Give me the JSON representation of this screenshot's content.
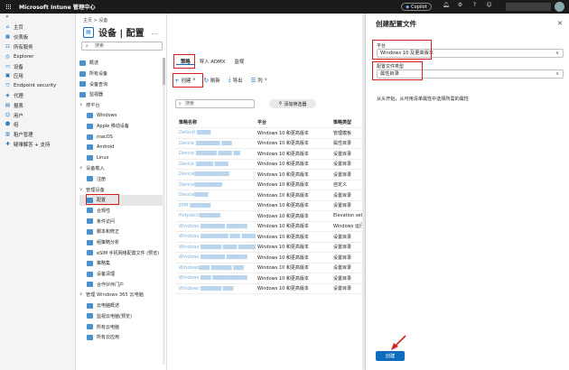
{
  "topbar": {
    "title": "Microsoft Intune 管理中心",
    "copilot": "Copilot",
    "icons": [
      "bell-icon",
      "gear-icon",
      "help-icon",
      "feedback-icon"
    ]
  },
  "leftnav": {
    "items": [
      {
        "icon": "home-icon",
        "label": "主页"
      },
      {
        "icon": "dashboard-icon",
        "label": "仪表板"
      },
      {
        "icon": "services-icon",
        "label": "所有服务"
      },
      {
        "icon": "explorer-icon",
        "label": "Explorer"
      },
      {
        "icon": "devices-icon",
        "label": "设备"
      },
      {
        "icon": "apps-icon",
        "label": "应用"
      },
      {
        "icon": "security-icon",
        "label": "Endpoint security"
      },
      {
        "icon": "agent-icon",
        "label": "代理"
      },
      {
        "icon": "reports-icon",
        "label": "报表"
      },
      {
        "icon": "users-icon",
        "label": "用户"
      },
      {
        "icon": "groups-icon",
        "label": "组"
      },
      {
        "icon": "tenant-icon",
        "label": "租户管理"
      },
      {
        "icon": "troubleshoot-icon",
        "label": "疑难解答 + 支持"
      }
    ]
  },
  "breadcrumb": [
    "主页",
    "设备"
  ],
  "page": {
    "title": "设备 | 配置",
    "more": "..."
  },
  "subnav": {
    "search_placeholder": "搜索",
    "items": [
      {
        "type": "item",
        "label": "概述"
      },
      {
        "type": "item",
        "label": "所有设备"
      },
      {
        "type": "item",
        "label": "设备查询"
      },
      {
        "type": "item",
        "label": "监视器"
      },
      {
        "type": "section",
        "label": "按平台"
      },
      {
        "type": "sub",
        "label": "Windows"
      },
      {
        "type": "sub",
        "label": "Apple 移动设备"
      },
      {
        "type": "sub",
        "label": "macOS"
      },
      {
        "type": "sub",
        "label": "Android"
      },
      {
        "type": "sub",
        "label": "Linux"
      },
      {
        "type": "section",
        "label": "设备载入"
      },
      {
        "type": "sub",
        "label": "注册"
      },
      {
        "type": "section",
        "label": "管理设备"
      },
      {
        "type": "sub",
        "label": "配置",
        "selected": true
      },
      {
        "type": "sub",
        "label": "合规性"
      },
      {
        "type": "sub",
        "label": "条件访问"
      },
      {
        "type": "sub",
        "label": "脚本和修正"
      },
      {
        "type": "sub",
        "label": "组策略分析"
      },
      {
        "type": "sub",
        "label": "eSIM 手机网络配置文件 (预览)"
      },
      {
        "type": "sub",
        "label": "策略集"
      },
      {
        "type": "sub",
        "label": "设备清理"
      },
      {
        "type": "sub",
        "label": "合作伙伴门户"
      },
      {
        "type": "section",
        "label": "管理 Windows 365 云电脑"
      },
      {
        "type": "sub",
        "label": "云电脑概述"
      },
      {
        "type": "sub",
        "label": "监视云电脑(预览)"
      },
      {
        "type": "sub",
        "label": "所有云电脑"
      },
      {
        "type": "sub",
        "label": "所有云应用"
      }
    ]
  },
  "tabs": [
    "策略",
    "导入 ADMX",
    "监视"
  ],
  "toolbar": {
    "create": "创建",
    "refresh": "刷新",
    "export": "导出",
    "columns": "列"
  },
  "filter": {
    "search_placeholder": "搜索",
    "add_filter": "添加筛选器"
  },
  "table": {
    "headers": [
      "策略名称",
      "平台",
      "策略类型"
    ],
    "rows": [
      {
        "platform": "Windows 10 和更高版本",
        "type": "管理模板"
      },
      {
        "platform": "Windows 10 和更高版本",
        "type": "属性目录"
      },
      {
        "platform": "Windows 10 和更高版本",
        "type": "设置目录"
      },
      {
        "platform": "Windows 10 和更高版本",
        "type": "设置目录"
      },
      {
        "platform": "Windows 10 和更高版本",
        "type": "设置目录"
      },
      {
        "platform": "Windows 10 和更高版本",
        "type": "自定义"
      },
      {
        "platform": "Windows 10 和更高版本",
        "type": "设置目录"
      },
      {
        "platform": "Windows 10 和更高版本",
        "type": "设置目录"
      },
      {
        "platform": "Windows 10 和更高版本",
        "type": "Elevation setting"
      },
      {
        "platform": "Windows 10 和更高版本",
        "type": "Windows 运行状"
      },
      {
        "platform": "Windows 10 和更高版本",
        "type": "设置目录"
      },
      {
        "platform": "Windows 10 和更高版本",
        "type": "设置目录"
      },
      {
        "platform": "Windows 10 和更高版本",
        "type": "设置目录"
      },
      {
        "platform": "Windows 10 和更高版本",
        "type": "设置目录"
      },
      {
        "platform": "Windows 10 和更高版本",
        "type": "设置目录"
      },
      {
        "platform": "Windows 10 和更高版本",
        "type": "设置目录"
      }
    ]
  },
  "panel": {
    "title": "创建配置文件",
    "platform_label": "平台",
    "platform_value": "Windows 10 及更高版本",
    "profile_type_label": "配置文件类型",
    "profile_type_value": "属性目录",
    "help_text": "从头开始，从可用清单属性中选择所需的属性",
    "create_button": "创建"
  },
  "colors": {
    "accent": "#0f6cbd",
    "highlight": "#d42020",
    "topbar": "#1b1b1b"
  }
}
